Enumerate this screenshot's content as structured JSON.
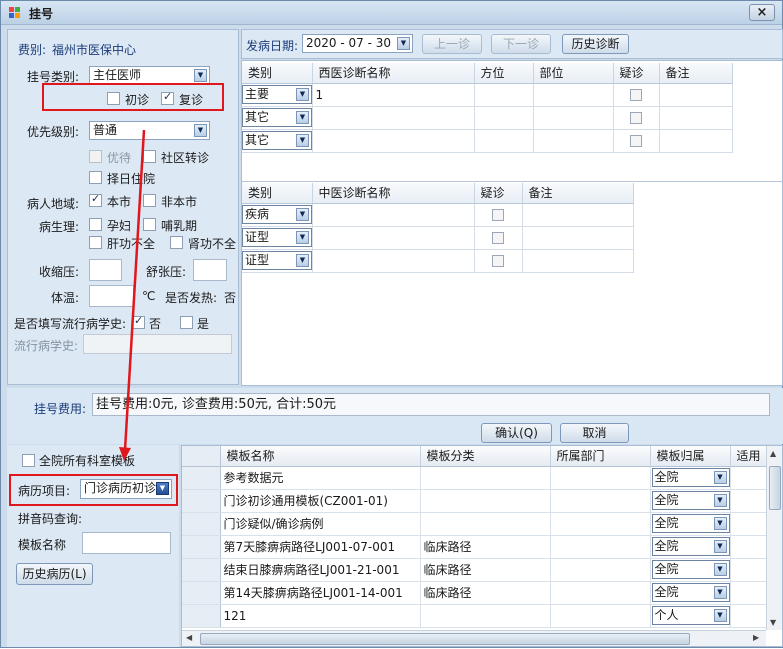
{
  "window": {
    "title": "挂号",
    "close": "×"
  },
  "left": {
    "fee_type_label": "费别:",
    "fee_type_value": "福州市医保中心",
    "reg_category_label": "挂号类别:",
    "reg_category_value": "主任医师",
    "first_visit_label": "初诊",
    "first_visit_checked": false,
    "return_visit_label": "复诊",
    "return_visit_checked": true,
    "priority_label": "优先级别:",
    "priority_value": "普通",
    "elderly_label": "优待",
    "community_label": "社区转诊",
    "scheduled_label": "择日住院",
    "region_label": "病人地域:",
    "local_label": "本市",
    "local_checked": true,
    "nonlocal_label": "非本市",
    "physiology_label": "病生理:",
    "pregnant_label": "孕妇",
    "lactation_label": "哺乳期",
    "liver_label": "肝功不全",
    "kidney_label": "肾功不全",
    "systolic_label": "收缩压:",
    "diastolic_label": "舒张压:",
    "temp_label": "体温:",
    "temp_unit": "℃",
    "fever_label": "是否发热:",
    "fever_value": "否",
    "epi_fill_label": "是否填写流行病学史:",
    "epi_no_label": "否",
    "epi_no_checked": true,
    "epi_yes_label": "是",
    "epi_history_label": "流行病学史:"
  },
  "top": {
    "onset_label": "发病日期:",
    "onset_value": "2020 - 07 - 30",
    "prev_btn": "上一诊",
    "next_btn": "下一诊",
    "history_btn": "历史诊断"
  },
  "western_grid": {
    "headers": [
      "类别",
      "西医诊断名称",
      "方位",
      "部位",
      "疑诊",
      "备注"
    ],
    "rows": [
      {
        "type": "主要",
        "name": "1"
      },
      {
        "type": "其它",
        "name": ""
      },
      {
        "type": "其它",
        "name": ""
      }
    ]
  },
  "tcm_grid": {
    "headers": [
      "类别",
      "中医诊断名称",
      "疑诊",
      "备注"
    ],
    "rows": [
      {
        "type": "疾病",
        "name": ""
      },
      {
        "type": "证型",
        "name": ""
      },
      {
        "type": "证型",
        "name": ""
      }
    ]
  },
  "fee": {
    "label": "挂号费用:",
    "value": "挂号费用:0元, 诊查费用:50元, 合计:50元",
    "confirm_btn": "确认(Q)",
    "cancel_btn": "取消"
  },
  "bottom_left": {
    "all_dept_label": "全院所有科室模板",
    "record_item_label": "病历项目:",
    "record_item_value": "门诊病历初诊",
    "pinyin_label": "拼音码查询:",
    "template_name_label": "模板名称",
    "history_btn": "历史病历(L)"
  },
  "template_grid": {
    "headers": [
      "模板名称",
      "模板分类",
      "所属部门",
      "模板归属",
      "适用"
    ],
    "rows": [
      {
        "name": "参考数据元",
        "category": "",
        "dept": "",
        "owner": "全院"
      },
      {
        "name": "门诊初诊通用模板(CZ001-01)",
        "category": "",
        "dept": "",
        "owner": "全院"
      },
      {
        "name": "门诊疑似/确诊病例",
        "category": "",
        "dept": "",
        "owner": "全院"
      },
      {
        "name": "第7天膝痹病路径LJ001-07-001",
        "category": "临床路径",
        "dept": "",
        "owner": "全院"
      },
      {
        "name": "结束日膝痹病路径LJ001-21-001",
        "category": "临床路径",
        "dept": "",
        "owner": "全院"
      },
      {
        "name": "第14天膝痹病路径LJ001-14-001",
        "category": "临床路径",
        "dept": "",
        "owner": "全院"
      },
      {
        "name": "121",
        "category": "",
        "dept": "",
        "owner": "个人"
      }
    ]
  },
  "colors": {
    "annotation_red": "#e0181e",
    "panel_bg": "#d9e6f3"
  }
}
